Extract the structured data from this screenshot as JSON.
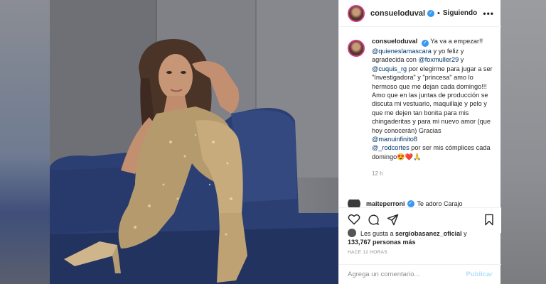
{
  "post": {
    "username": "consueloduval",
    "follow_status": "Siguiendo",
    "caption_intro": "Ya va a empezar!!",
    "mentions": {
      "m1": "@quieneslamascara",
      "m2": "@foxmuller29",
      "m3": "@cuquis_rg",
      "m4": "@manuinfinito8",
      "m5": "@_rodcortes"
    },
    "caption_parts": {
      "p1": " y yo feliz y agradecida con ",
      "p2": " y ",
      "p3": " por elegirme para jugar a ser \"Investigadora\" y \"princesa\" amo lo hermoso que me dejan cada domingo!!! Amo que en las juntas de producción se discuta mi vestuario, maquillaje y pelo y que me dejen tan bonita para mis chingaderitas y para mi nuevo amor (que hoy conocerán) Gracias",
      "p4": " por ser mis cómplices cada domingo😍❤️🙏"
    },
    "time_ago": "12 h",
    "next_comment_user": "maiteperroni",
    "next_comment_text": "Te adoro Carajo",
    "likes_prefix": "Les gusta a ",
    "likes_user": "sergiobasanez_oficial",
    "likes_suffix": " y",
    "likes_count": "133,767 personas más",
    "posted_time": "HACE 12 HORAS",
    "comment_placeholder": "Agrega un comentario...",
    "publish_label": "Publicar"
  },
  "colors": {
    "mention": "#00376b",
    "verified": "#3897f0",
    "publish": "#b2dffc",
    "sofa": "#2c3f73"
  },
  "icons": [
    "verified-badge-icon",
    "more-options-icon",
    "heart-icon",
    "comment-icon",
    "share-icon",
    "bookmark-icon",
    "next-arrow-icon"
  ]
}
